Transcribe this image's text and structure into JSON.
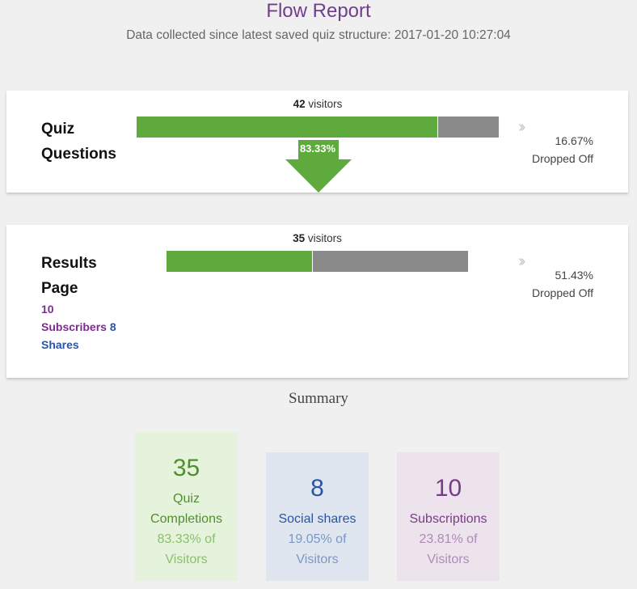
{
  "header": {
    "title": "Flow Report",
    "subtitle": "Data collected since latest saved quiz structure: 2017-01-20 10:27:04"
  },
  "stages": [
    {
      "title_line1": "Quiz",
      "title_line2": "Questions",
      "visitors_count": "42",
      "visitors_label": "visitors",
      "pass_fraction": 0.8333,
      "pass_label": "83.33%",
      "drop_pct": "16.67%",
      "drop_label": "Dropped Off"
    },
    {
      "title_line1": "Results",
      "title_line2": "Page",
      "visitors_count": "35",
      "visitors_label": "visitors",
      "pass_fraction": 0.4857,
      "drop_pct": "51.43%",
      "drop_label": "Dropped Off",
      "subscribers_count": "10",
      "subscribers_label": "Subscribers",
      "shares_count": "8",
      "shares_label": "Shares"
    }
  ],
  "summary": {
    "title": "Summary",
    "boxes": [
      {
        "value": "35",
        "label_line1": "Quiz",
        "label_line2": "Completions",
        "pct_line1": "83.33% of",
        "pct_line2": "Visitors"
      },
      {
        "value": "8",
        "label_line1": "Social shares",
        "pct_line1": "19.05% of",
        "pct_line2": "Visitors"
      },
      {
        "value": "10",
        "label_line1": "Subscriptions",
        "pct_line1": "23.81% of",
        "pct_line2": "Visitors"
      }
    ]
  },
  "colors": {
    "accent_purple": "#6f3f8d",
    "pass_green": "#5eaa3c",
    "drop_gray": "#8a8a8a",
    "shares_blue": "#2a55a4"
  },
  "icons": {
    "stage_next": "double-chevron-right-icon"
  }
}
